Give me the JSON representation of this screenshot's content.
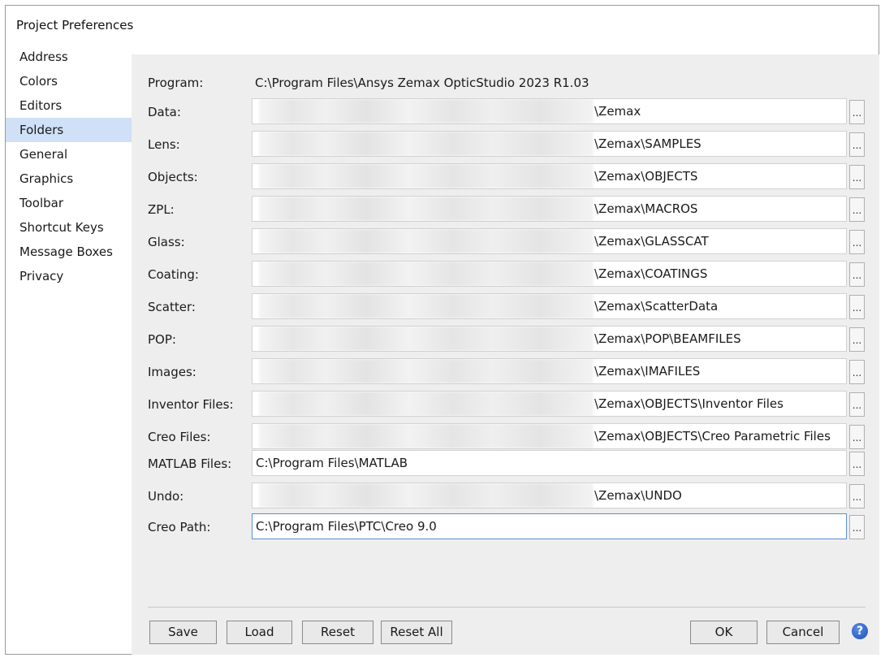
{
  "window": {
    "title": "Project Preferences"
  },
  "sidebar": {
    "items": [
      {
        "label": "Address",
        "selected": false
      },
      {
        "label": "Colors",
        "selected": false
      },
      {
        "label": "Editors",
        "selected": false
      },
      {
        "label": "Folders",
        "selected": true
      },
      {
        "label": "General",
        "selected": false
      },
      {
        "label": "Graphics",
        "selected": false
      },
      {
        "label": "Toolbar",
        "selected": false
      },
      {
        "label": "Shortcut Keys",
        "selected": false
      },
      {
        "label": "Message Boxes",
        "selected": false
      },
      {
        "label": "Privacy",
        "selected": false
      }
    ]
  },
  "folders": {
    "program": {
      "label": "Program:",
      "value": "C:\\Program Files\\Ansys Zemax OpticStudio 2023 R1.03"
    },
    "rows": [
      {
        "label": "Data:",
        "value": "\\Zemax",
        "blurred": true
      },
      {
        "label": "Lens:",
        "value": "\\Zemax\\SAMPLES",
        "blurred": true
      },
      {
        "label": "Objects:",
        "value": "\\Zemax\\OBJECTS",
        "blurred": true
      },
      {
        "label": "ZPL:",
        "value": "\\Zemax\\MACROS",
        "blurred": true
      },
      {
        "label": "Glass:",
        "value": "\\Zemax\\GLASSCAT",
        "blurred": true
      },
      {
        "label": "Coating:",
        "value": "\\Zemax\\COATINGS",
        "blurred": true
      },
      {
        "label": "Scatter:",
        "value": "\\Zemax\\ScatterData",
        "blurred": true
      },
      {
        "label": "POP:",
        "value": "\\Zemax\\POP\\BEAMFILES",
        "blurred": true
      },
      {
        "label": "Images:",
        "value": "\\Zemax\\IMAFILES",
        "blurred": true
      },
      {
        "label": "Inventor Files:",
        "value": "\\Zemax\\OBJECTS\\Inventor Files",
        "blurred": true
      },
      {
        "label": "Creo Files:",
        "value": "\\Zemax\\OBJECTS\\Creo Parametric Files",
        "blurred": true
      },
      {
        "label": "MATLAB Files:",
        "value": "C:\\Program Files\\MATLAB",
        "blurred": false
      },
      {
        "label": "Undo:",
        "value": "\\Zemax\\UNDO",
        "blurred": true
      },
      {
        "label": "Creo Path:",
        "value": "C:\\Program Files\\PTC\\Creo 9.0",
        "blurred": false,
        "focused": true
      }
    ],
    "browse_label": "..."
  },
  "buttons": {
    "save": "Save",
    "load": "Load",
    "reset": "Reset",
    "reset_all": "Reset All",
    "ok": "OK",
    "cancel": "Cancel",
    "help": "?"
  },
  "colors": {
    "selection": "#cfe0f7",
    "panel": "#eeeeee",
    "help_icon": "#1b4fb5"
  }
}
